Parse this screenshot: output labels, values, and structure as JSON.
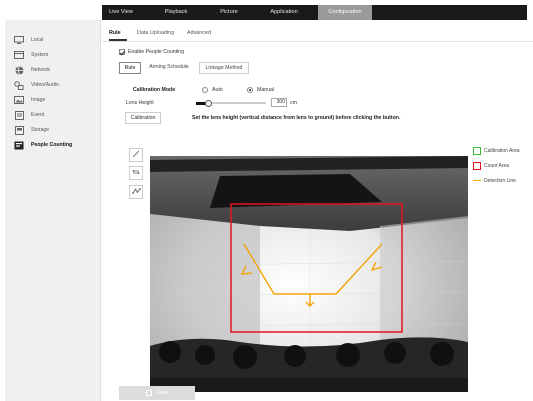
{
  "topnav": {
    "items": [
      "Live View",
      "Playback",
      "Picture",
      "Application",
      "Configuration"
    ],
    "active": "Configuration"
  },
  "sidebar": {
    "items": [
      {
        "label": "Local",
        "icon": "monitor-icon"
      },
      {
        "label": "System",
        "icon": "system-icon"
      },
      {
        "label": "Network",
        "icon": "globe-icon"
      },
      {
        "label": "Video/Audio",
        "icon": "video-audio-icon"
      },
      {
        "label": "Image",
        "icon": "image-icon"
      },
      {
        "label": "Event",
        "icon": "event-icon"
      },
      {
        "label": "Storage",
        "icon": "storage-icon"
      },
      {
        "label": "People Counting",
        "icon": "people-counting-icon"
      }
    ],
    "active": "People Counting"
  },
  "tabs": [
    "Rule",
    "Data Uploading",
    "Advanced"
  ],
  "active_tab": "Rule",
  "enable_label": "Enable People Counting",
  "enable_checked": true,
  "subtabs": [
    "Rule",
    "Arming Schedule",
    "Linkage Method"
  ],
  "active_subtab": "Rule",
  "calibration_mode": {
    "label": "Calibration Mode",
    "options": [
      "Auto",
      "Manual"
    ],
    "selected": "Manual"
  },
  "lens_height": {
    "label": "Lens Height",
    "value": "300",
    "unit": "cm"
  },
  "calibration_button": "Calibration",
  "hint": "Set the lens height (vertical distance from lens to ground) before clicking the button.",
  "legend": [
    {
      "label": "Calibration Area",
      "color": "#2fbf2f"
    },
    {
      "label": "Count Area",
      "color": "#e0141e"
    },
    {
      "label": "Detection Line",
      "color": "#f2a40a"
    }
  ],
  "save_button": "Save",
  "tools": [
    "pencil-icon",
    "zoom-fit-icon",
    "polyline-icon"
  ]
}
